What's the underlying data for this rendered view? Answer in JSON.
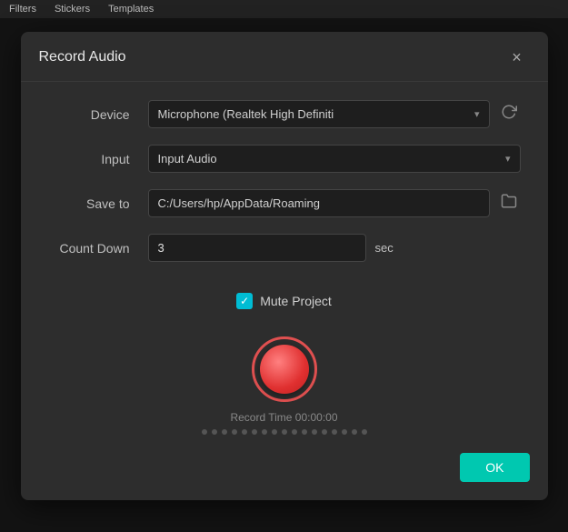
{
  "topbar": {
    "items": [
      "Filters",
      "Stickers",
      "Templates"
    ]
  },
  "dialog": {
    "title": "Record Audio",
    "close_label": "×",
    "fields": {
      "device_label": "Device",
      "device_value": "Microphone (Realtek High Definiti",
      "input_label": "Input",
      "input_value": "Input Audio",
      "saveto_label": "Save to",
      "saveto_value": "C:/Users/hp/AppData/Roaming",
      "countdown_label": "Count Down",
      "countdown_value": "3",
      "sec_label": "sec"
    },
    "mute": {
      "label": "Mute Project",
      "checked": true
    },
    "record": {
      "time_label": "Record Time 00:00:00",
      "dots_count": 17
    },
    "footer": {
      "ok_label": "OK"
    }
  },
  "colors": {
    "accent_teal": "#00c8b0",
    "record_red": "#e03030",
    "checkbox_teal": "#00bcd4"
  }
}
